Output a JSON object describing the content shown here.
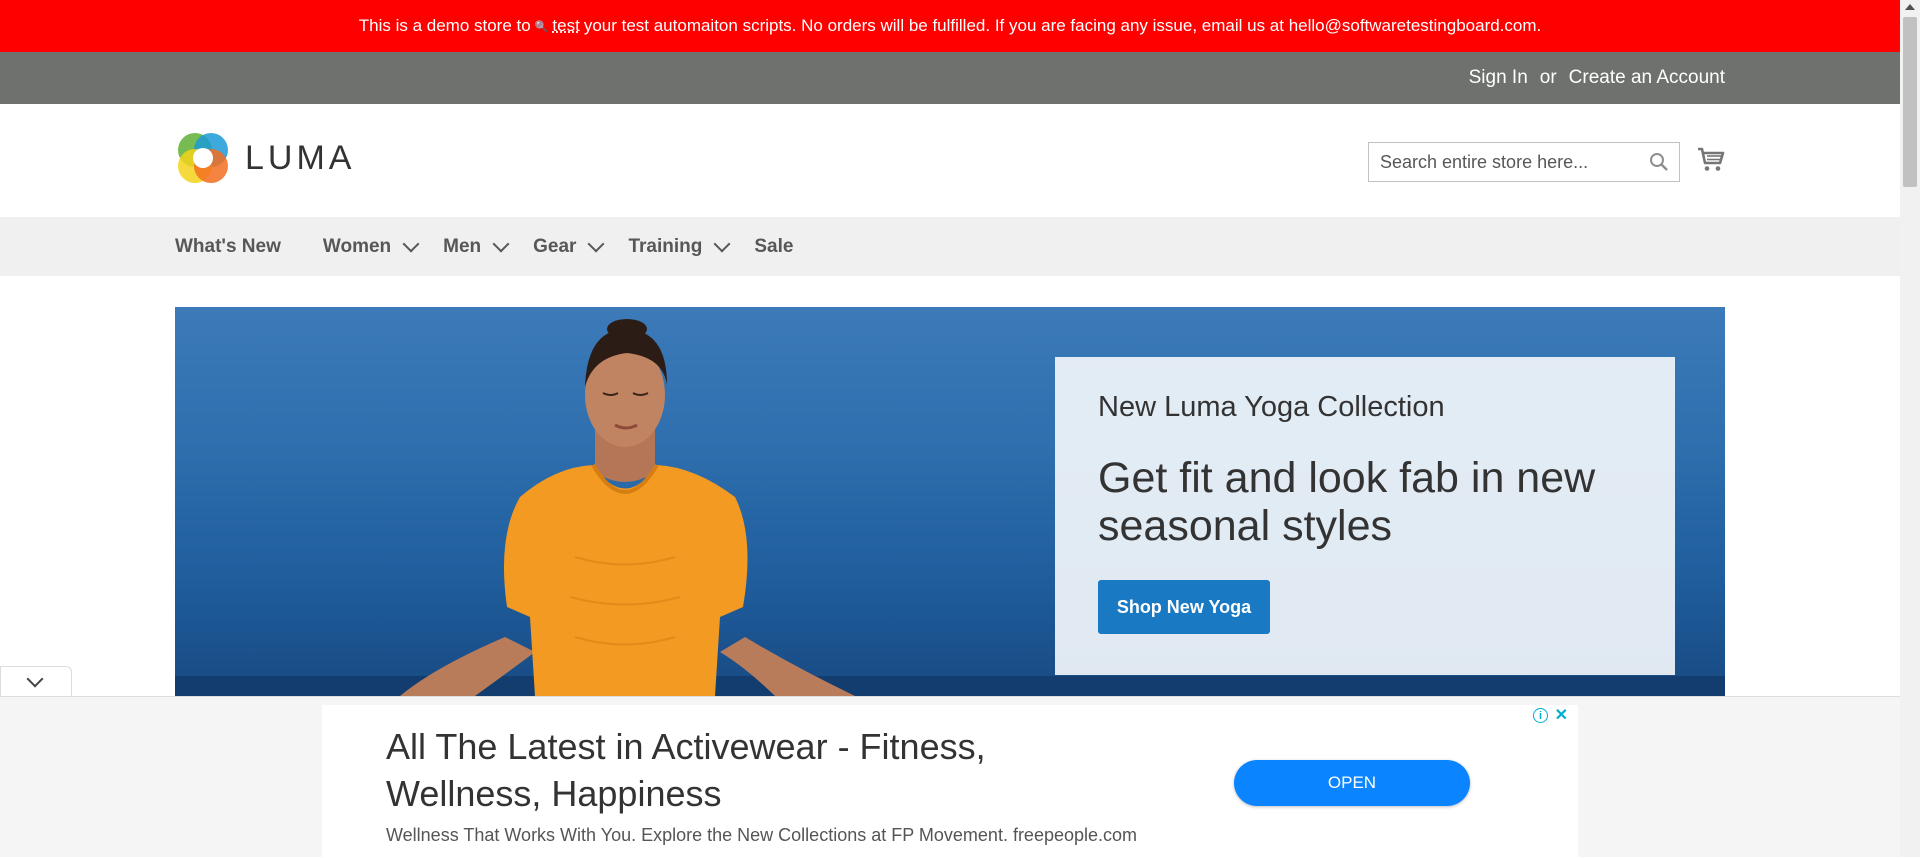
{
  "demo_banner": {
    "text_before": "This is a demo store to",
    "search_glyph": "🔍",
    "underlined_word": "test",
    "text_after": "your test automaiton scripts. No orders will be fulfilled. If you are facing any issue, email us at hello@softwaretestingboard.com."
  },
  "top_bar": {
    "sign_in": "Sign In",
    "or": "or",
    "create_account": "Create an Account"
  },
  "header": {
    "logo_text": "LUMA",
    "search": {
      "placeholder": "Search entire store here...",
      "value": ""
    },
    "icons": {
      "search": "search-icon",
      "cart": "cart-icon"
    }
  },
  "nav": {
    "items": [
      {
        "label": "What's New",
        "has_dropdown": false
      },
      {
        "label": "Women",
        "has_dropdown": true
      },
      {
        "label": "Men",
        "has_dropdown": true
      },
      {
        "label": "Gear",
        "has_dropdown": true
      },
      {
        "label": "Training",
        "has_dropdown": true
      },
      {
        "label": "Sale",
        "has_dropdown": false
      }
    ]
  },
  "hero": {
    "subtitle": "New Luma Yoga Collection",
    "title": "Get fit and look fab in new seasonal styles",
    "button": "Shop New Yoga"
  },
  "ad": {
    "title": "All The Latest in Activewear - Fitness, Wellness, Happiness",
    "description": "Wellness That Works With You. Explore the New Collections at FP Movement. freepeople.com",
    "button": "OPEN",
    "info_glyph": "i",
    "close_glyph": "✕"
  },
  "colors": {
    "banner": "#ff0000",
    "top_bar": "#6e716e",
    "nav_bg": "#f0f0f0",
    "primary_button": "#1979c3",
    "ad_button": "#0a84ff"
  }
}
